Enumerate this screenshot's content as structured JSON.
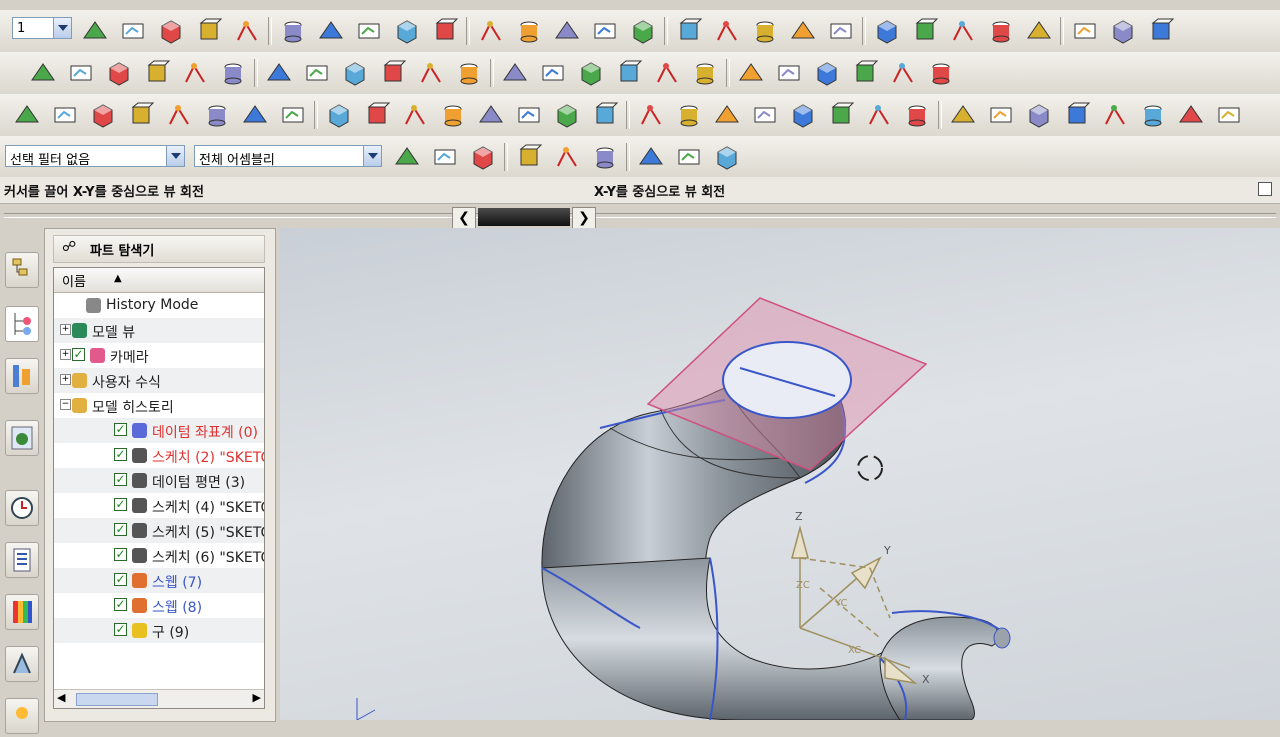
{
  "toolbar": {
    "layer_select_value": "1",
    "selection_filter_value": "선택 필터 없음",
    "assembly_scope_value": "전체 어셈블리"
  },
  "status": {
    "prompt_left": "커서를 끌어 X-Y를 중심으로 뷰 회전",
    "prompt_right": "X-Y를 중심으로 뷰 회전"
  },
  "navigator": {
    "title": "파트 탐색기",
    "column_name": "이름",
    "items": [
      {
        "label": "History Mode",
        "color": "#222222"
      },
      {
        "label": "모델 뷰",
        "color": "#222222"
      },
      {
        "label": "카메라",
        "color": "#222222"
      },
      {
        "label": "사용자 수식",
        "color": "#222222"
      },
      {
        "label": "모델 히스토리",
        "color": "#222222"
      },
      {
        "label": "데이텀 좌표계 (0)",
        "color": "#e03030"
      },
      {
        "label": "스케치 (2) \"SKETC",
        "color": "#e03030"
      },
      {
        "label": "데이텀 평면 (3)",
        "color": "#222222"
      },
      {
        "label": "스케치 (4) \"SKETC",
        "color": "#222222"
      },
      {
        "label": "스케치 (5) \"SKETC",
        "color": "#222222"
      },
      {
        "label": "스케치 (6) \"SKETC",
        "color": "#222222"
      },
      {
        "label": "스웹 (7)",
        "color": "#3a56c8"
      },
      {
        "label": "스웹 (8)",
        "color": "#3a56c8"
      },
      {
        "label": "구 (9)",
        "color": "#222222"
      }
    ]
  },
  "viewport": {
    "axis_labels": {
      "z": "Z",
      "y": "Y",
      "x": "X",
      "zc": "ZC",
      "yc": "YC",
      "xc": "XC"
    }
  },
  "colors": {
    "accent": "#3a56c8",
    "error_red": "#e03030",
    "plane_pink": "#e08aa8"
  }
}
